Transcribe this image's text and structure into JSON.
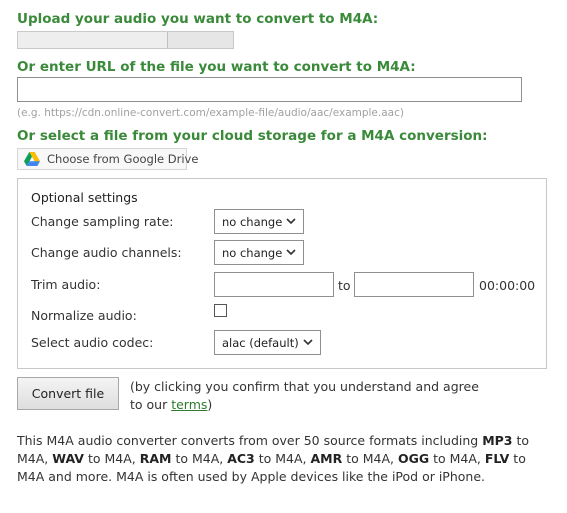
{
  "upload": {
    "heading": "Upload your audio you want to convert to M4A:"
  },
  "url": {
    "heading": "Or enter URL of the file you want to convert to M4A:",
    "value": "",
    "hint": "(e.g. https://cdn.online-convert.com/example-file/audio/aac/example.aac)"
  },
  "cloud": {
    "heading": "Or select a file from your cloud storage for a M4A conversion:",
    "google_drive_label": "Choose from Google Drive",
    "google_drive_icon": "google-drive-icon"
  },
  "settings": {
    "title": "Optional settings",
    "sampling_rate": {
      "label": "Change sampling rate:",
      "value": "no change"
    },
    "audio_channels": {
      "label": "Change audio channels:",
      "value": "no change"
    },
    "trim": {
      "label": "Trim audio:",
      "from": "",
      "to_label": "to",
      "to": "",
      "time": "00:00:00"
    },
    "normalize": {
      "label": "Normalize audio:",
      "checked": false
    },
    "codec": {
      "label": "Select audio codec:",
      "value": "alac (default)"
    }
  },
  "convert": {
    "button_label": "Convert file",
    "confirm_line1": "(by clicking you confirm that you understand and agree",
    "confirm_line2_prefix": "to our ",
    "terms_link": "terms",
    "confirm_line2_suffix": ")"
  },
  "description": {
    "p1": "This M4A audio converter converts from over 50 source formats including ",
    "f_mp3": "MP3",
    "t_mp3": " to M4A, ",
    "f_wav": "WAV",
    "t_wav": " to M4A, ",
    "f_ram": "RAM",
    "t_ram": " to M4A, ",
    "f_ac3": "AC3",
    "t_ac3": " to M4A, ",
    "f_amr": "AMR",
    "t_amr": " to M4A, ",
    "f_ogg": "OGG",
    "t_ogg": " to M4A, ",
    "f_flv": "FLV",
    "t_flv": " to M4A and more. M4A is often used by Apple devices like the iPod or iPhone."
  },
  "colors": {
    "heading_green": "#3a8a3a",
    "link_green": "#2c7a2c"
  }
}
